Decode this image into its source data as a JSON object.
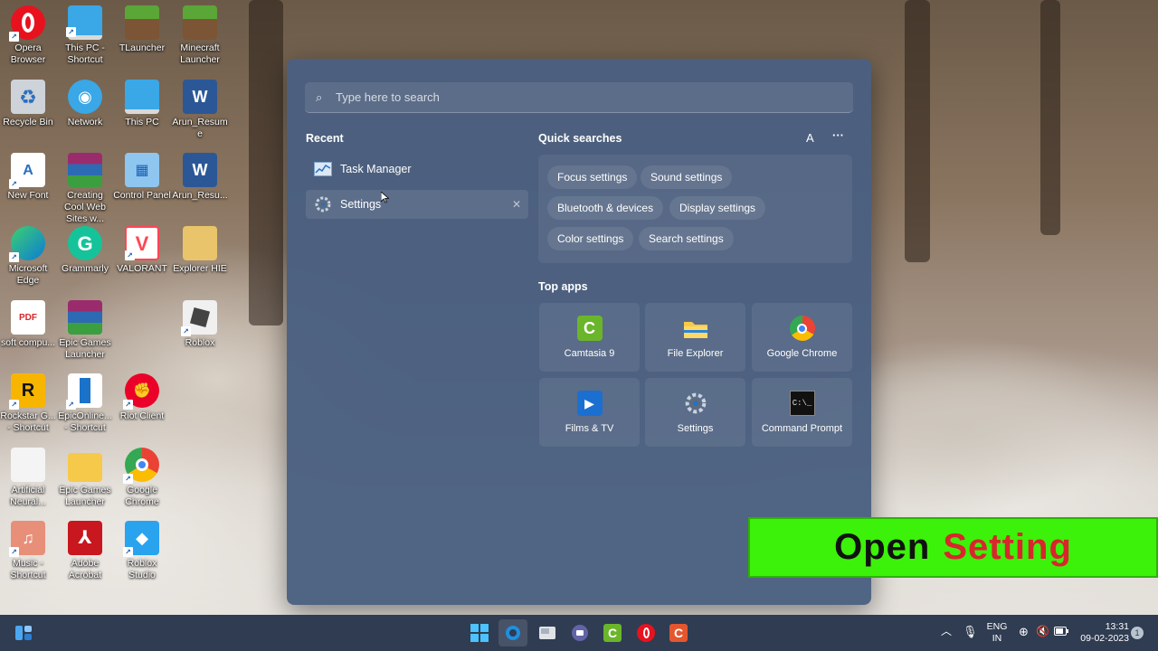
{
  "desktop": {
    "icons": [
      {
        "label": "Opera Browser"
      },
      {
        "label": "This PC - Shortcut"
      },
      {
        "label": "TLauncher"
      },
      {
        "label": "Minecraft Launcher"
      },
      {
        "label": "Recycle Bin"
      },
      {
        "label": "Network"
      },
      {
        "label": "This PC"
      },
      {
        "label": "Arun_Resume"
      },
      {
        "label": "New Font"
      },
      {
        "label": "Creating Cool Web Sites w..."
      },
      {
        "label": "Control Panel"
      },
      {
        "label": "Arun_Resu..."
      },
      {
        "label": "Microsoft Edge"
      },
      {
        "label": "Grammarly"
      },
      {
        "label": "VALORANT"
      },
      {
        "label": "Explorer HIE"
      },
      {
        "label": "soft compu..."
      },
      {
        "label": "Epic Games Launcher"
      },
      {
        "label": "Roblox"
      },
      {
        "label": "Rockstar G... - Shortcut"
      },
      {
        "label": "EpicOnline... - Shortcut"
      },
      {
        "label": "Riot Client"
      },
      {
        "label": "Artificial Neural..."
      },
      {
        "label": "Epic Games Launcher"
      },
      {
        "label": "Google Chrome"
      },
      {
        "label": "Music - Shortcut"
      },
      {
        "label": "Adobe Acrobat"
      },
      {
        "label": "Roblox Studio"
      }
    ]
  },
  "start_menu": {
    "search_placeholder": "Type here to search",
    "recent_title": "Recent",
    "recent": [
      {
        "label": "Task Manager"
      },
      {
        "label": "Settings"
      }
    ],
    "quick_title": "Quick searches",
    "quick_font_btn": "A",
    "quick_more_btn": "···",
    "quick_searches": [
      {
        "label": "Focus settings"
      },
      {
        "label": "Sound settings"
      },
      {
        "label": "Bluetooth & devices"
      },
      {
        "label": "Display settings"
      },
      {
        "label": "Color settings"
      },
      {
        "label": "Search settings"
      }
    ],
    "top_apps_title": "Top apps",
    "top_apps": [
      {
        "label": "Camtasia 9"
      },
      {
        "label": "File Explorer"
      },
      {
        "label": "Google Chrome"
      },
      {
        "label": "Films & TV"
      },
      {
        "label": "Settings"
      },
      {
        "label": "Command Prompt"
      }
    ]
  },
  "banner": {
    "word1": "Open",
    "word2": "Setting"
  },
  "taskbar": {
    "lang_line1": "ENG",
    "lang_line2": "IN",
    "time": "13:31",
    "date": "09-02-2023",
    "notif_count": "1"
  },
  "colors": {
    "start_bg": "#4a5f80",
    "taskbar_bg": "#2f3c52",
    "banner_bg": "#3cf10a",
    "banner_accent": "#d8262c"
  }
}
